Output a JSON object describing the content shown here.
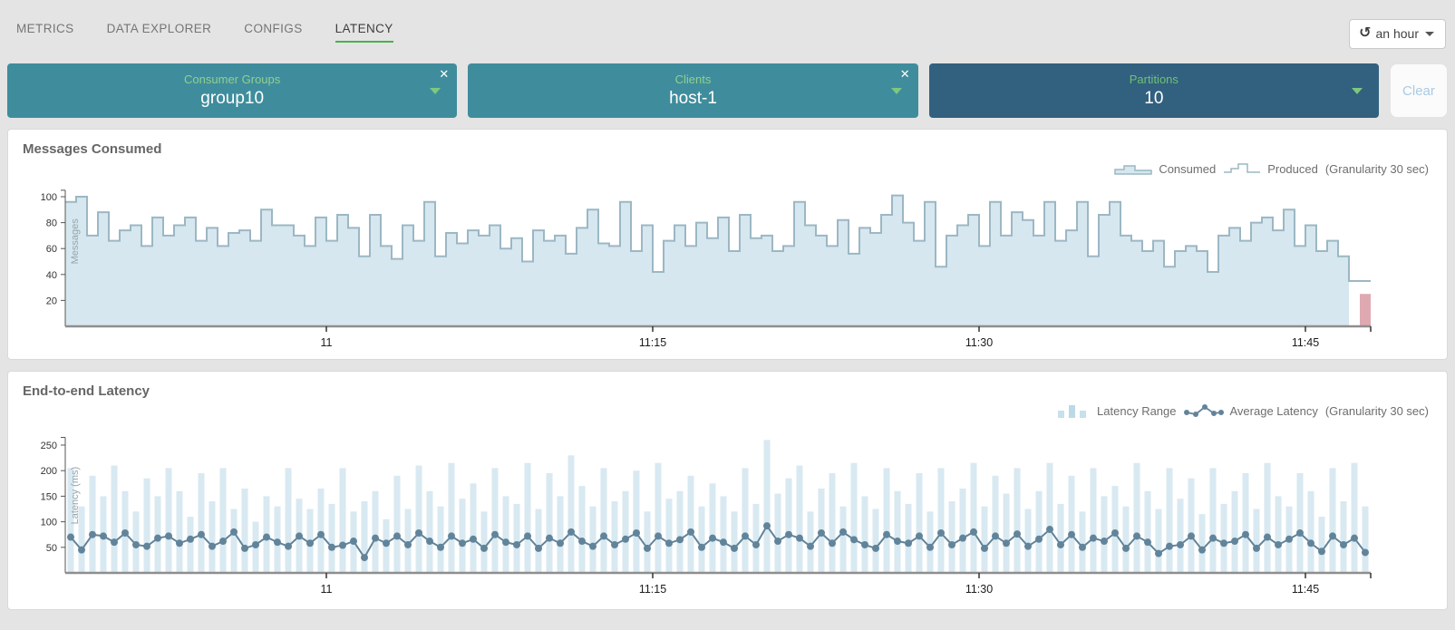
{
  "nav": {
    "tabs": [
      {
        "label": "METRICS",
        "active": false
      },
      {
        "label": "DATA EXPLORER",
        "active": false
      },
      {
        "label": "CONFIGS",
        "active": false
      },
      {
        "label": "LATENCY",
        "active": true
      }
    ]
  },
  "time_selector": {
    "label": "an hour"
  },
  "filters": {
    "cards": [
      {
        "title": "Consumer Groups",
        "value": "group10",
        "closable": true,
        "style": "teal"
      },
      {
        "title": "Clients",
        "value": "host-1",
        "closable": true,
        "style": "teal"
      },
      {
        "title": "Partitions",
        "value": "10",
        "closable": false,
        "style": "navy"
      }
    ],
    "clear_label": "Clear"
  },
  "panels": {
    "messages": {
      "title": "Messages Consumed",
      "legend": {
        "series1": "Consumed",
        "series2": "Produced",
        "note": "(Granularity 30 sec)"
      }
    },
    "latency": {
      "title": "End-to-end Latency",
      "legend": {
        "series1": "Latency Range",
        "series2": "Average Latency",
        "note": "(Granularity 30 sec)"
      }
    }
  },
  "colors": {
    "teal_card": "#3f8d9c",
    "navy_card": "#32607f",
    "label_green": "#8fd092",
    "tab_underline_green": "#4caf50",
    "clear_text_blue": "#a9cbe5",
    "step_fill": "#d6e7ef",
    "step_stroke": "#9cb7c4",
    "lag_bar_red": "#dfa9b2",
    "latency_bar": "#d8e9f1",
    "avg_line": "#62849a"
  },
  "chart_data": [
    {
      "type": "area",
      "variant": "step-area-with-step-line",
      "title": "Messages Consumed",
      "ylabel": "Messages",
      "xlabel": "",
      "granularity_sec": 30,
      "ylim": [
        0,
        105
      ],
      "y_ticks": [
        20,
        40,
        60,
        80,
        100
      ],
      "x_ticks": [
        {
          "label": "11",
          "min": 12
        },
        {
          "label": "11:15",
          "min": 27
        },
        {
          "label": "11:30",
          "min": 42
        },
        {
          "label": "11:45",
          "min": 57
        }
      ],
      "x_range_minutes": 60,
      "points_per_minute": 2,
      "legend_position": "top-right",
      "series": [
        {
          "name": "Consumed",
          "style": "step-area",
          "values": [
            96,
            100,
            70,
            88,
            66,
            74,
            78,
            62,
            84,
            70,
            78,
            84,
            66,
            76,
            62,
            72,
            74,
            66,
            90,
            78,
            78,
            70,
            62,
            84,
            66,
            86,
            76,
            54,
            86,
            62,
            52,
            78,
            66,
            96,
            54,
            72,
            64,
            74,
            70,
            78,
            60,
            68,
            50,
            74,
            66,
            70,
            56,
            76,
            90,
            64,
            62,
            96,
            58,
            78,
            42,
            66,
            78,
            62,
            80,
            68,
            84,
            58,
            86,
            68,
            70,
            58,
            62,
            96,
            78,
            70,
            62,
            82,
            56,
            76,
            72,
            86,
            101,
            80,
            66,
            96,
            46,
            70,
            78,
            86,
            62,
            96,
            70,
            88,
            82,
            70,
            96,
            66,
            74,
            96,
            54,
            86,
            96,
            70,
            66,
            58,
            66,
            46,
            58,
            62,
            58,
            42,
            70,
            76,
            66,
            80,
            84,
            74,
            90,
            62,
            78,
            58,
            66,
            54
          ]
        },
        {
          "name": "Produced",
          "style": "step-line",
          "overlaps_consumed": true,
          "tail_values": [
            35,
            35
          ]
        }
      ],
      "anomaly_bar": {
        "slot": 119,
        "value": 25,
        "color": "#dfa9b2"
      }
    },
    {
      "type": "bar",
      "variant": "range-bars-with-average-line",
      "title": "End-to-end Latency",
      "ylabel": "Latency (ms)",
      "xlabel": "",
      "granularity_sec": 30,
      "ylim": [
        0,
        265
      ],
      "y_ticks": [
        50,
        100,
        150,
        200,
        250
      ],
      "x_ticks": [
        {
          "label": "11",
          "min": 12
        },
        {
          "label": "11:15",
          "min": 27
        },
        {
          "label": "11:30",
          "min": 42
        },
        {
          "label": "11:45",
          "min": 57
        }
      ],
      "x_range_minutes": 60,
      "points_per_minute": 2,
      "legend_position": "top-right",
      "series": [
        {
          "name": "Latency Range",
          "style": "bar",
          "values": [
            205,
            130,
            190,
            150,
            210,
            160,
            120,
            185,
            150,
            205,
            160,
            110,
            195,
            140,
            205,
            125,
            165,
            100,
            150,
            130,
            205,
            145,
            125,
            165,
            135,
            205,
            120,
            140,
            160,
            105,
            190,
            125,
            210,
            160,
            130,
            215,
            145,
            175,
            120,
            205,
            150,
            135,
            215,
            125,
            195,
            150,
            230,
            170,
            130,
            205,
            140,
            160,
            200,
            120,
            215,
            145,
            160,
            190,
            130,
            175,
            150,
            120,
            205,
            135,
            260,
            155,
            185,
            210,
            120,
            165,
            195,
            130,
            215,
            150,
            125,
            205,
            160,
            135,
            195,
            120,
            205,
            140,
            165,
            215,
            130,
            190,
            155,
            205,
            125,
            160,
            215,
            135,
            190,
            120,
            205,
            150,
            170,
            130,
            215,
            160,
            125,
            205,
            145,
            185,
            115,
            205,
            135,
            160,
            195,
            125,
            215,
            150,
            130,
            195,
            160,
            110,
            205,
            140,
            215,
            130
          ]
        },
        {
          "name": "Average Latency",
          "style": "line-dots",
          "values": [
            70,
            45,
            75,
            72,
            60,
            78,
            55,
            52,
            68,
            72,
            58,
            66,
            75,
            52,
            62,
            80,
            48,
            55,
            70,
            60,
            52,
            72,
            58,
            75,
            50,
            54,
            62,
            30,
            68,
            58,
            72,
            55,
            78,
            62,
            50,
            72,
            58,
            66,
            48,
            75,
            60,
            55,
            72,
            48,
            68,
            58,
            80,
            62,
            52,
            72,
            55,
            66,
            78,
            48,
            72,
            58,
            65,
            80,
            50,
            68,
            60,
            48,
            72,
            55,
            92,
            62,
            75,
            68,
            52,
            78,
            58,
            80,
            65,
            55,
            48,
            75,
            62,
            58,
            72,
            50,
            78,
            55,
            68,
            80,
            48,
            72,
            58,
            76,
            52,
            66,
            85,
            55,
            75,
            50,
            68,
            62,
            78,
            48,
            72,
            60,
            38,
            52,
            55,
            72,
            45,
            68,
            58,
            62,
            75,
            48,
            70,
            55,
            66,
            78,
            58,
            42,
            72,
            55,
            68,
            40
          ]
        }
      ]
    }
  ]
}
